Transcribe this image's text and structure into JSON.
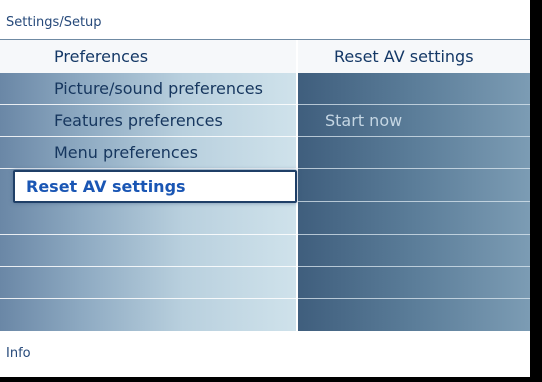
{
  "breadcrumb": "Settings/Setup",
  "menu": {
    "title": "Preferences",
    "items": [
      {
        "label": "Picture/sound preferences"
      },
      {
        "label": "Features preferences"
      },
      {
        "label": "Menu preferences"
      },
      {
        "label": "Reset AV settings",
        "selected": true
      },
      {
        "label": ""
      },
      {
        "label": ""
      },
      {
        "label": ""
      }
    ]
  },
  "submenu": {
    "title": "Reset AV settings",
    "items": [
      {
        "label": ""
      },
      {
        "label": "Start now"
      },
      {
        "label": ""
      },
      {
        "label": ""
      },
      {
        "label": ""
      },
      {
        "label": ""
      },
      {
        "label": ""
      }
    ]
  },
  "info_label": "Info",
  "colors": {
    "text": "#16365e",
    "selected_text": "#1a56b4",
    "right_panel": "#4f7190"
  }
}
